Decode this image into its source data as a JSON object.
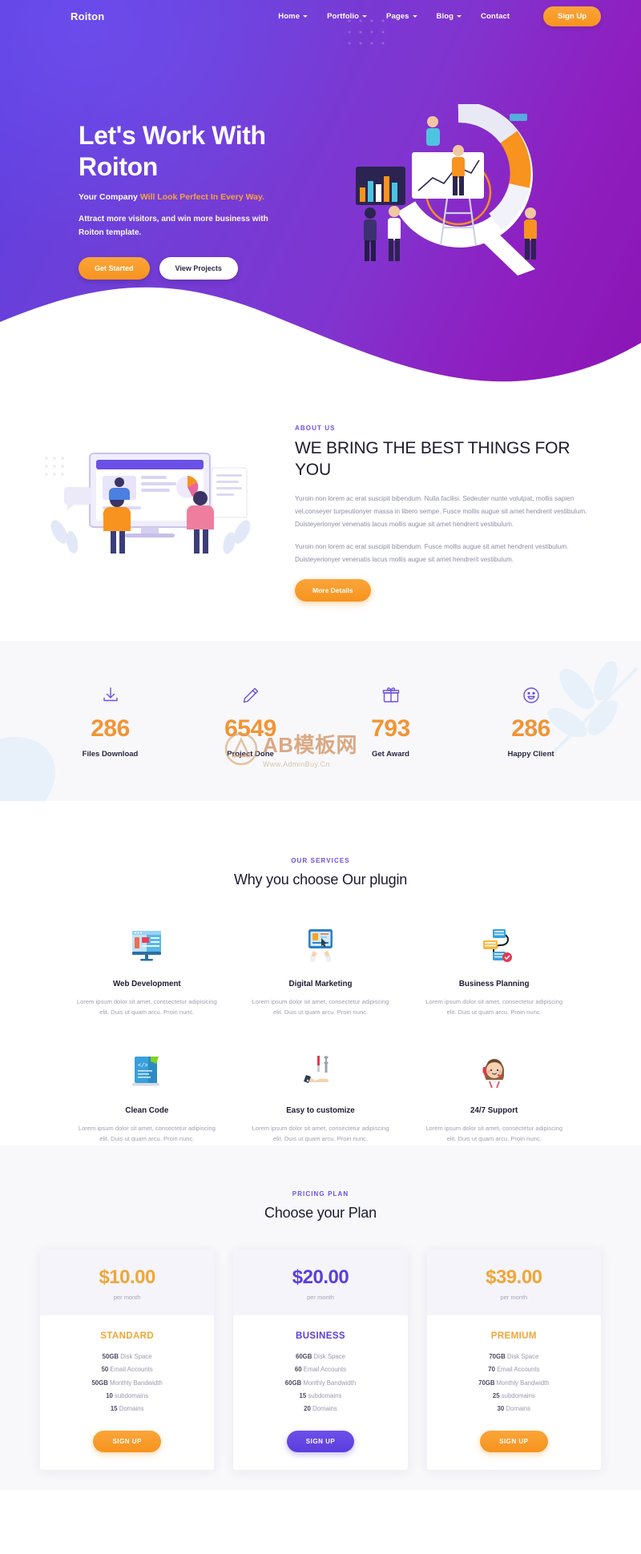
{
  "nav": {
    "brand": "Roiton",
    "items": [
      {
        "label": "Home",
        "has_dropdown": true
      },
      {
        "label": "Portfolio",
        "has_dropdown": true
      },
      {
        "label": "Pages",
        "has_dropdown": true
      },
      {
        "label": "Blog",
        "has_dropdown": true
      },
      {
        "label": "Contact",
        "has_dropdown": false
      }
    ],
    "cta_label": "Sign Up"
  },
  "hero": {
    "title_line1": "Let's Work With",
    "title_line2": "Roiton",
    "subtitle_plain": "Your Company ",
    "subtitle_accent": "Will Look Perfect In Every Way.",
    "description": "Attract more visitors, and win more business with Roiton template.",
    "primary_btn": "Get Started",
    "secondary_btn": "View Projects"
  },
  "about": {
    "eyebrow": "ABOUT US",
    "heading": "WE BRING THE BEST THINGS FOR YOU",
    "paragraph1": "Yuroin non lorem ac erat suscipit bibendum. Nulla facilisi. Sedeuter nunte volutpat, mollis sapien vel,conseyer turpeutionyer massa in libero sempe. Fusce mollis augue sit amet hendrerit vestibulum. Duisteyerionyer venenatis lacus mollis augue sit amet hendrerit vestibulum.",
    "paragraph2": "Yuroin non lorem ac erat suscipit bibendum. Fusce mollis augue sit amet hendrent vestibulum. Duisteyerionyer venenatis lacus mollis augue sit amet hendrerit vestibulum.",
    "button": "More Details"
  },
  "counters": [
    {
      "icon": "download-icon",
      "value": "286",
      "label": "Files Download"
    },
    {
      "icon": "pencil-icon",
      "value": "6549",
      "label": "Project Done"
    },
    {
      "icon": "gift-icon",
      "value": "793",
      "label": "Get Award"
    },
    {
      "icon": "smile-icon",
      "value": "286",
      "label": "Happy Client"
    }
  ],
  "watermark": {
    "text": "AB模板网",
    "sub": "Www.AdminBuy.Cn"
  },
  "services": {
    "eyebrow": "OUR SERVICES",
    "title": "Why you choose Our plugin",
    "items": [
      {
        "icon": "monitor-webpage-icon",
        "name": "Web Development",
        "desc": "Lorem ipsum dolor sit amet, contsectetur adipisicing elit. Duis ut quam arcu. Proin nunc."
      },
      {
        "icon": "tablet-hands-icon",
        "name": "Digital Marketing",
        "desc": "Lorem ipsum dolor sit amet, consectetur adipiscing elit. Duis ut quam arcu. Proin nunc."
      },
      {
        "icon": "flowchart-icon",
        "name": "Business Planning",
        "desc": "Lorem ipsum dolor sit amet, consectetur adipiscing elit. Duis ut quam arcu. Proin nunc."
      },
      {
        "icon": "code-laptop-icon",
        "name": "Clean Code",
        "desc": "Lorem ipsum dolor sit amet, consectetur adipiscing elit. Duis ut quam arcu. Proin nunc."
      },
      {
        "icon": "hand-tools-icon",
        "name": "Easy to customize",
        "desc": "Lorem ipsum dolor sit amet, consectetur adipiscing elit. Duis ut quam arcu. Proin nunc."
      },
      {
        "icon": "support-agent-icon",
        "name": "24/7 Support",
        "desc": "Lorem ipsum dolor sit amet, consectetur adipiscing elit. Duis ut quam arcu. Proin nunc."
      }
    ]
  },
  "pricing": {
    "eyebrow": "PRICING PLAN",
    "title": "Choose your Plan",
    "plans": [
      {
        "amount": "$10.00",
        "per": "per month",
        "name": "STANDARD",
        "accent": "#f0a638",
        "features": [
          {
            "value": "50GB",
            "text": " Disk Space"
          },
          {
            "value": "50",
            "text": " Email Accounts"
          },
          {
            "value": "50GB",
            "text": " Monthly Bandwidth"
          },
          {
            "value": "10",
            "text": " subdomains"
          },
          {
            "value": "15",
            "text": " Domains"
          }
        ],
        "button": "SIGN UP",
        "button_style": "orange"
      },
      {
        "amount": "$20.00",
        "per": "per month",
        "name": "BUSINESS",
        "accent": "#5b3ddd",
        "features": [
          {
            "value": "60GB",
            "text": " Disk Space"
          },
          {
            "value": "60",
            "text": " Email Accounts"
          },
          {
            "value": "60GB",
            "text": " Monthly Bandwidth"
          },
          {
            "value": "15",
            "text": " subdomains"
          },
          {
            "value": "20",
            "text": " Domains"
          }
        ],
        "button": "SIGN UP",
        "button_style": "purple"
      },
      {
        "amount": "$39.00",
        "per": "per month",
        "name": "PREMIUM",
        "accent": "#f0a638",
        "features": [
          {
            "value": "70GB",
            "text": " Disk Space"
          },
          {
            "value": "70",
            "text": " Email Accounts"
          },
          {
            "value": "70GB",
            "text": " Monthly Bandwidth"
          },
          {
            "value": "25",
            "text": " subdomains"
          },
          {
            "value": "30",
            "text": " Domains"
          }
        ],
        "button": "SIGN UP",
        "button_style": "orange"
      }
    ]
  },
  "colors": {
    "brand_purple": "#5b3ddd",
    "accent_orange": "#f7931e",
    "hero_gradient_start": "#5b3fe0",
    "hero_gradient_end": "#8c14b4",
    "counter_number": "#f29434",
    "body_text": "#8d8da6"
  }
}
